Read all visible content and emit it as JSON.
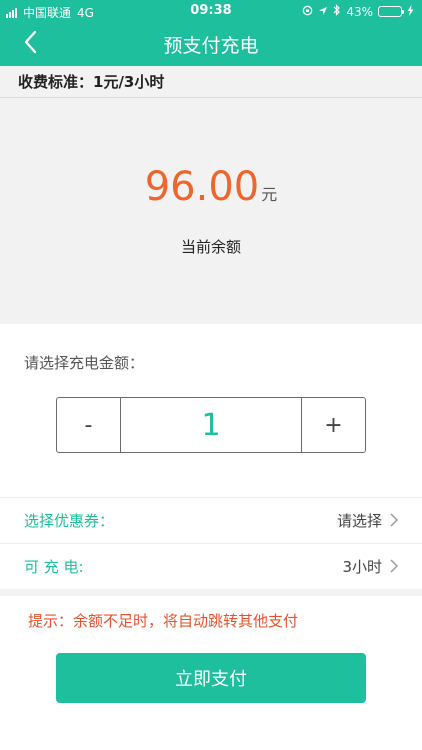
{
  "status_bar": {
    "carrier": "中国联通",
    "network": "4G",
    "time": "09:38",
    "battery": "43%",
    "battery_level": 0.43
  },
  "nav": {
    "title": "预支付充电",
    "back_icon": "chevron-left-icon"
  },
  "standard": {
    "text": "收费标准：1元/3小时"
  },
  "balance": {
    "amount": "96.00",
    "unit": "元",
    "label": "当前余额"
  },
  "amount_select": {
    "label": "请选择充电金额：",
    "minus": "-",
    "value": "1",
    "plus": "+"
  },
  "coupon": {
    "label": "选择优惠券：",
    "value": "请选择"
  },
  "charge_time": {
    "label": "可 充 电:",
    "value": "3小时"
  },
  "hint": {
    "text": "提示：余额不足时，将自动跳转其他支付"
  },
  "pay_button": {
    "label": "立即支付"
  },
  "colors": {
    "primary": "#1dbf9c",
    "amount": "#f0652b",
    "hint": "#e8522a"
  }
}
